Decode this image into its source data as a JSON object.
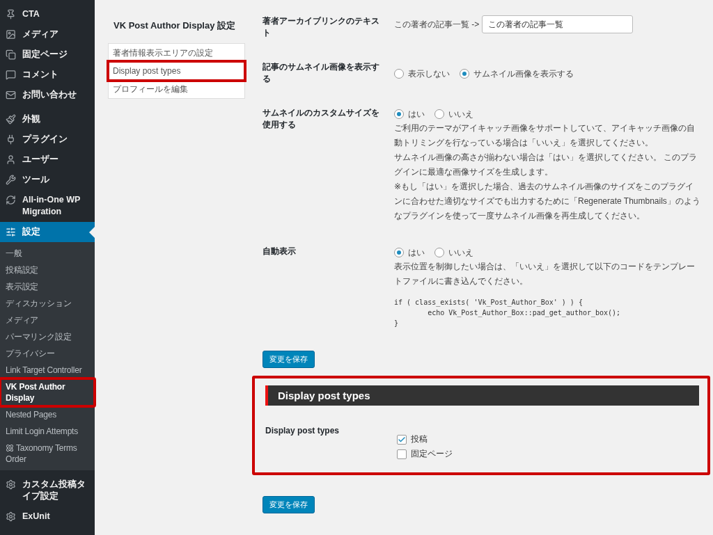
{
  "sidebar": {
    "groups": [
      [
        {
          "label": "CTA",
          "selected": false
        },
        {
          "label": "メディア",
          "selected": false
        },
        {
          "label": "固定ページ",
          "selected": false
        },
        {
          "label": "コメント",
          "selected": false
        },
        {
          "label": "お問い合わせ",
          "selected": false
        }
      ],
      [
        {
          "label": "外観",
          "selected": false
        },
        {
          "label": "プラグイン",
          "selected": false
        },
        {
          "label": "ユーザー",
          "selected": false
        },
        {
          "label": "ツール",
          "selected": false
        },
        {
          "label": "All-in-One WP Migration",
          "selected": false
        },
        {
          "label": "設定",
          "selected": true,
          "children": [
            {
              "label": "一般",
              "selected": false,
              "kind": "plain"
            },
            {
              "label": "投稿設定",
              "selected": false,
              "kind": "plain"
            },
            {
              "label": "表示設定",
              "selected": false,
              "kind": "plain"
            },
            {
              "label": "ディスカッション",
              "selected": false,
              "kind": "plain"
            },
            {
              "label": "メディア",
              "selected": false,
              "kind": "plain"
            },
            {
              "label": "パーマリンク設定",
              "selected": false,
              "kind": "plain"
            },
            {
              "label": "プライバシー",
              "selected": false,
              "kind": "plain"
            },
            {
              "label": "Link Target Controller",
              "selected": false,
              "kind": "plain"
            },
            {
              "label": "VK Post Author Display",
              "selected": true,
              "highlighted": true,
              "kind": "plain"
            },
            {
              "label": "Nested Pages",
              "selected": false,
              "kind": "plain"
            },
            {
              "label": "Limit Login Attempts",
              "selected": false,
              "kind": "plain"
            },
            {
              "label": "Taxonomy Terms Order",
              "selected": false,
              "kind": "icon"
            }
          ]
        }
      ],
      [
        {
          "label": "カスタム投稿タイプ設定",
          "selected": false
        },
        {
          "label": "ExUnit",
          "selected": false
        }
      ]
    ]
  },
  "settings_nav": {
    "title": "VK Post Author Display 設定",
    "items": [
      {
        "label": "著者情報表示エリアの設定",
        "highlighted": false
      },
      {
        "label": "Display post types",
        "highlighted": true
      },
      {
        "label": "プロフィールを編集",
        "highlighted": false
      }
    ]
  },
  "form": {
    "rows": [
      {
        "label": "著者アーカイブリンクのテキスト",
        "kind": "input",
        "prefix": "この著者の記事一覧 ->",
        "value": "この著者の記事一覧"
      },
      {
        "label": "記事のサムネイル画像を表示する",
        "kind": "radio",
        "options": [
          {
            "label": "表示しない",
            "selected": false
          },
          {
            "label": "サムネイル画像を表示する",
            "selected": true
          }
        ]
      },
      {
        "label": "サムネイルのカスタムサイズを使用する",
        "kind": "radio",
        "options": [
          {
            "label": "はい",
            "selected": true
          },
          {
            "label": "いいえ",
            "selected": false
          }
        ],
        "description": [
          "ご利用のテーマがアイキャッチ画像をサポートしていて、アイキャッチ画像の自動トリミングを行なっている場合は「いいえ」を選択してください。",
          "サムネイル画像の高さが揃わない場合は「はい」を選択してください。 このプラグインに最適な画像サイズを生成します。",
          "※もし「はい」を選択した場合、過去のサムネイル画像のサイズをこのプラグインに合わせた適切なサイズでも出力するために「Regenerate Thumbnails」のようなプラグインを使って一度サムネイル画像を再生成してください。"
        ]
      },
      {
        "label": "自動表示",
        "kind": "radio",
        "options": [
          {
            "label": "はい",
            "selected": true
          },
          {
            "label": "いいえ",
            "selected": false
          }
        ],
        "description": [
          "表示位置を制御したい場合は、「いいえ」を選択して以下のコードをテンプレートファイルに書き込んでください。"
        ],
        "code": [
          "if ( class_exists( 'Vk_Post_Author_Box' ) ) {",
          "        echo Vk_Post_Author_Box::pad_get_author_box();",
          "}"
        ]
      }
    ],
    "save_button": "変更を保存"
  },
  "section": {
    "title": "Display post types",
    "highlighted": true,
    "rows": [
      {
        "label": "Display post types",
        "options": [
          {
            "label": "投稿",
            "checked": true
          },
          {
            "label": "固定ページ",
            "checked": false
          }
        ]
      }
    ],
    "save_button": "変更を保存"
  }
}
